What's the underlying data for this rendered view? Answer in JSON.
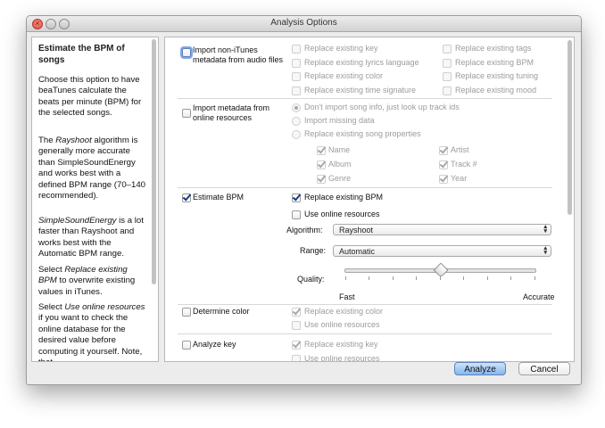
{
  "window": {
    "title": "Analysis Options"
  },
  "help": {
    "title": "Estimate the BPM of songs",
    "p1": "Choose this option to have beaTunes calculate the beats per minute (BPM) for the selected songs.",
    "p2_pre": "The ",
    "p2_em": "Rayshoot",
    "p2_post": " algorithm is generally more accurate than SimpleSoundEnergy and works best with a defined BPM range (70–140 recommended).",
    "p3_em": "SimpleSoundEnergy",
    "p3_post": " is a lot faster than Rayshoot and works best with the Automatic BPM range.",
    "p4_pre": "Select ",
    "p4_em": "Replace existing BPM",
    "p4_post": " to overwrite existing values in iTunes.",
    "p5_pre": "Select ",
    "p5_em": "Use online resources",
    "p5_post": " if you want to check the online database for the desired value before computing it yourself. Note, that"
  },
  "sections": {
    "import_non_itunes": {
      "label": "Import non-iTunes metadata from audio files",
      "options": {
        "replace_key": "Replace existing key",
        "replace_tags": "Replace existing tags",
        "replace_lyrics_language": "Replace existing lyrics language",
        "replace_bpm": "Replace existing BPM",
        "replace_color": "Replace existing color",
        "replace_tuning": "Replace existing tuning",
        "replace_time_signature": "Replace existing time signature",
        "replace_mood": "Replace existing mood"
      }
    },
    "import_online": {
      "label": "Import metadata from online resources",
      "radio_no_import": "Don't import song info, just look up track ids",
      "radio_missing": "Import missing data",
      "radio_replace": "Replace existing song properties",
      "props": {
        "name": "Name",
        "artist": "Artist",
        "album": "Album",
        "track": "Track #",
        "genre": "Genre",
        "year": "Year"
      }
    },
    "estimate_bpm": {
      "label": "Estimate BPM",
      "replace_existing": "Replace existing BPM",
      "use_online": "Use online resources",
      "algorithm_label": "Algorithm:",
      "algorithm_value": "Rayshoot",
      "range_label": "Range:",
      "range_value": "Automatic",
      "quality_label": "Quality:",
      "quality_min": "Fast",
      "quality_max": "Accurate",
      "quality_level": 0.5
    },
    "determine_color": {
      "label": "Determine color",
      "replace_existing": "Replace existing color",
      "use_online": "Use online resources"
    },
    "analyze_key": {
      "label": "Analyze key",
      "replace_existing": "Replace existing key",
      "use_online": "Use online resources"
    }
  },
  "buttons": {
    "analyze": "Analyze",
    "cancel": "Cancel"
  }
}
